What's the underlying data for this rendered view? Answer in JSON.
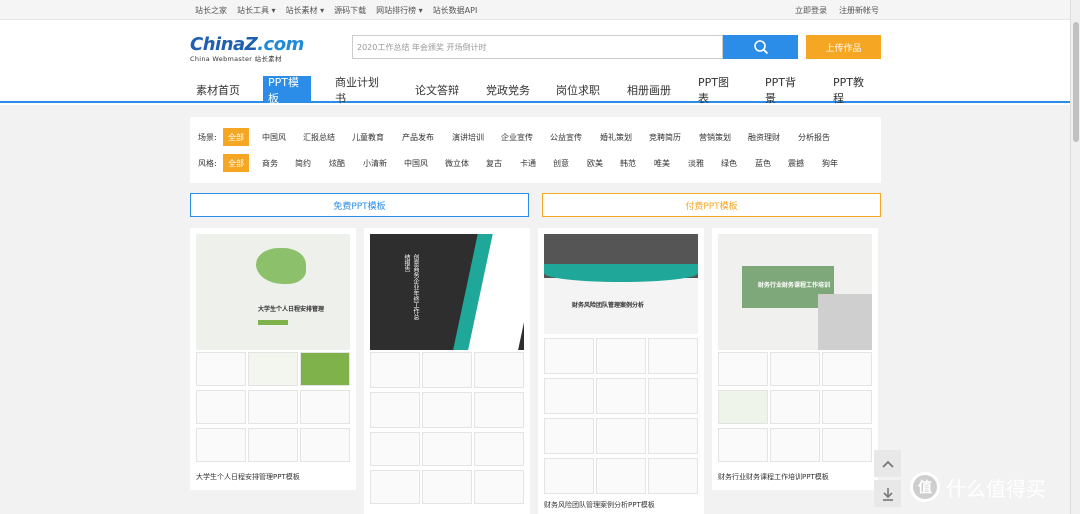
{
  "topbar": {
    "links": [
      "站长之家",
      "站长工具 ▾",
      "站长素材 ▾",
      "源码下载",
      "网站排行榜 ▾",
      "站长数据API"
    ],
    "login": "立即登录",
    "register": "注册新帐号"
  },
  "logo": {
    "name_left": "China",
    "name_z": "Z",
    "name_right": ".com",
    "sub": "China Webmaster 站长素材"
  },
  "search": {
    "placeholder": "2020工作总结 年会颁奖 开场倒计时"
  },
  "upload_label": "上传作品",
  "nav": [
    "素材首页",
    "PPT模板",
    "商业计划书",
    "论文答辩",
    "党政党务",
    "岗位求职",
    "相册画册",
    "PPT图表",
    "PPT背景",
    "PPT教程"
  ],
  "filters": {
    "scene": {
      "label": "场景:",
      "tags": [
        "全部",
        "中国风",
        "汇报总结",
        "儿童教育",
        "产品发布",
        "演讲培训",
        "企业宣传",
        "公益宣传",
        "婚礼策划",
        "竞聘简历",
        "营销策划",
        "融资理财",
        "分析报告"
      ]
    },
    "style": {
      "label": "风格:",
      "tags": [
        "全部",
        "商务",
        "简约",
        "炫酷",
        "小清新",
        "中国风",
        "微立体",
        "复古",
        "卡通",
        "创意",
        "欧美",
        "韩范",
        "唯美",
        "淡雅",
        "绿色",
        "蓝色",
        "震撼",
        "狗年"
      ]
    }
  },
  "tabs": {
    "free": "免费PPT模板",
    "paid": "付费PPT模板"
  },
  "cards": [
    {
      "title": "大学生个人日程安排管理PPT模板",
      "cover_text": "大学生个人日程安排管理"
    },
    {
      "title": "",
      "cover_text": "创意商务企业年终工作总结报告"
    },
    {
      "title": "财务风险团队管理案例分析PPT模板",
      "cover_text": "财务风险团队管理案例分析"
    },
    {
      "title": "财务行业财务课程工作培训PPT模板",
      "cover_text": "财务行业财务课程工作培训"
    }
  ],
  "watermark": {
    "glyph": "值",
    "text": "什么值得买"
  },
  "colors": {
    "accent": "#2b8de8",
    "orange": "#f5a623",
    "green": "#7fb24a",
    "teal": "#1fa89a"
  }
}
